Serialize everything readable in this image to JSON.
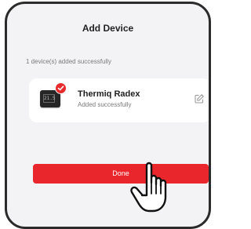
{
  "dialog": {
    "title": "Add Device",
    "status_text": "1 device(s) added successfully"
  },
  "device": {
    "name": "Thermiq Radex",
    "subtitle": "Added successfully",
    "display_text": "21.5",
    "icon": "thermostat-icon",
    "badge_icon": "check-icon",
    "edit_icon": "edit-icon"
  },
  "actions": {
    "done_label": "Done"
  },
  "cursor": {
    "icon": "hand-pointer-icon"
  },
  "colors": {
    "accent": "#e8262c",
    "badge": "#e52b2b",
    "background": "#f3f3f5",
    "card": "#ffffff"
  }
}
